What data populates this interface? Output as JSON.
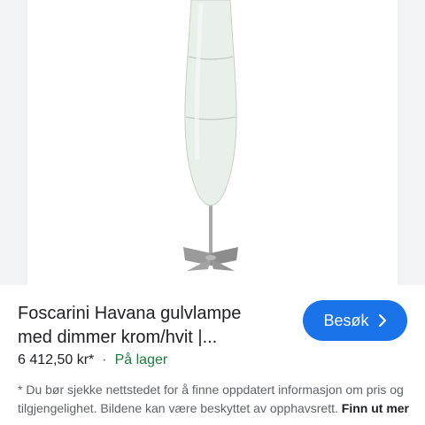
{
  "product": {
    "title_line1": "Foscarini Havana gulvlampe",
    "title_line2": "med dimmer krom/hvit |...",
    "price": "6 412,50 kr*",
    "separator": "·",
    "availability": "På lager",
    "image_icon": "floor-lamp-image"
  },
  "actions": {
    "visit_label": "Besøk",
    "visit_icon": "chevron-right-icon"
  },
  "disclaimer": {
    "text": "* Du bør sjekke nettstedet for å finne oppdatert informasjon om pris og tilgjengelighet. Bildene kan være beskyttet av opphavsrett.",
    "link_label": "Finn ut mer"
  },
  "colors": {
    "accent": "#1a73e8",
    "in_stock": "#188038",
    "lamp_shade": "#e9efe9",
    "lamp_base": "#9a9a9a"
  }
}
